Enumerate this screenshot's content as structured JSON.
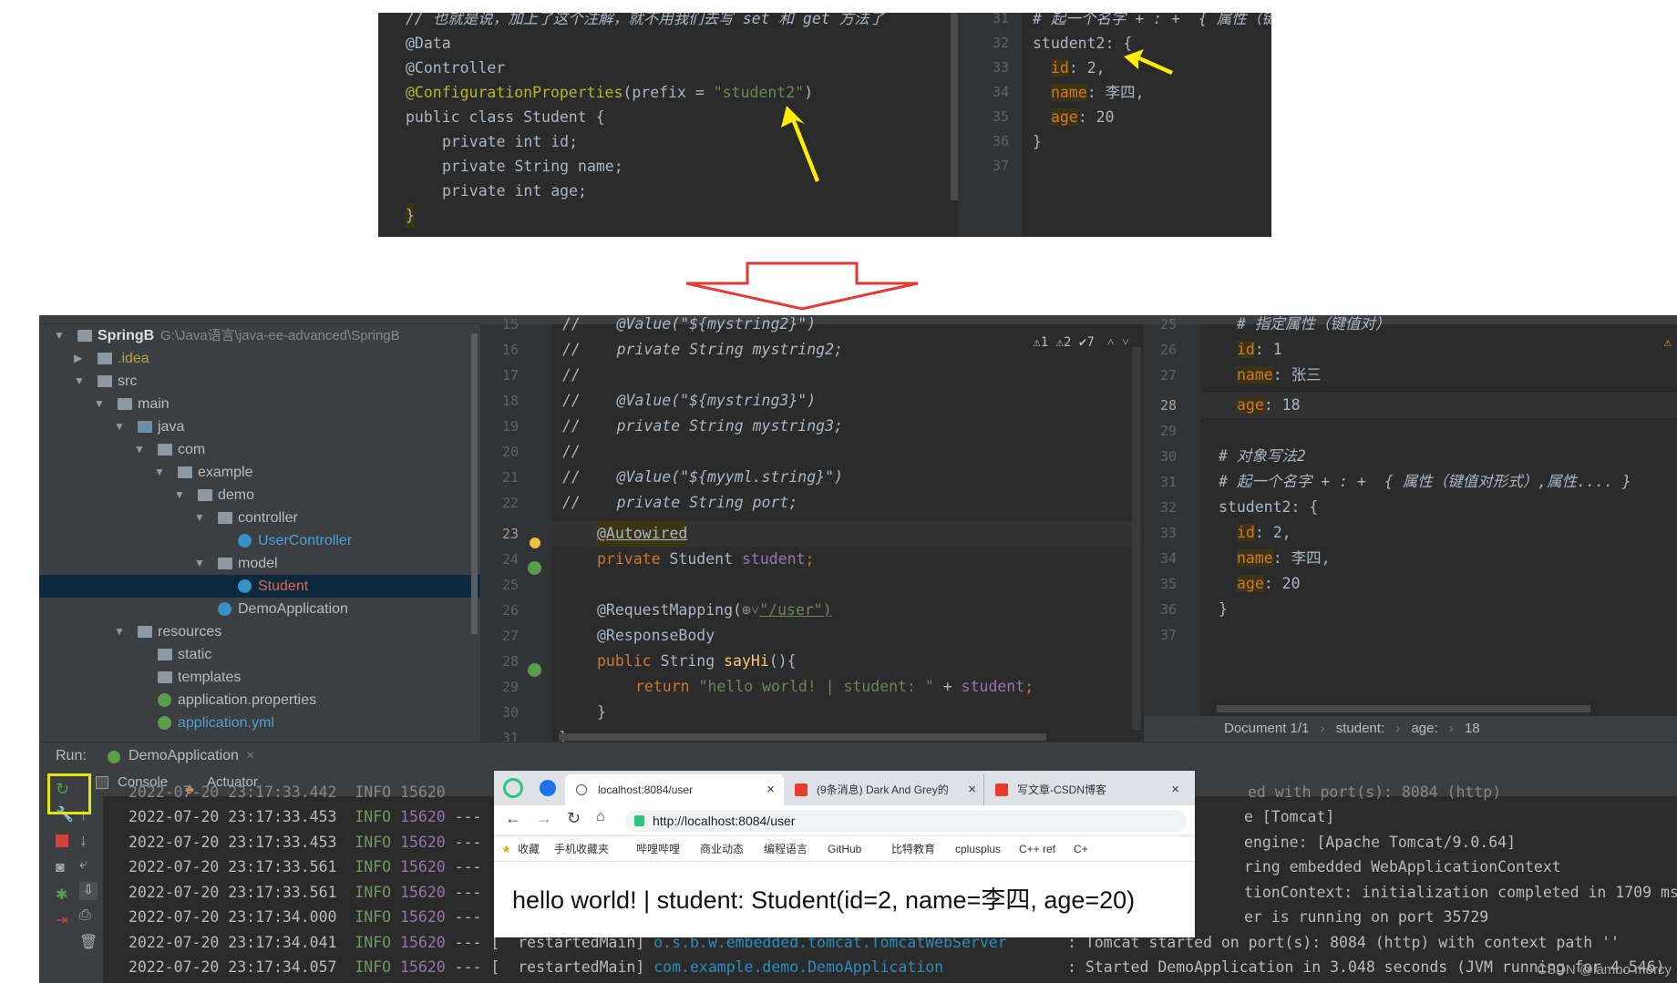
{
  "top_snippet": {
    "comment_line": "// 也就是说，加上了这个注解，就不用我们去写 set 和 get 方法了",
    "lines": [
      "@Data",
      "@Controller"
    ],
    "config_annotation": "@ConfigurationProperties",
    "config_prefix": "(prefix = ",
    "config_value": "\"student2\"",
    "class_decl": "public class Student {",
    "fields": [
      "private int id;",
      "private String name;",
      "private int age;"
    ],
    "closing": "}",
    "gutter": [
      "31",
      "32",
      "33",
      "34",
      "35",
      "36",
      "37"
    ],
    "yml_comment": "# 起一个名字 + : +  { 属性（键",
    "yml_root": "student2: {",
    "yml_entries": [
      {
        "key": "id",
        "value": ": 2,"
      },
      {
        "key": "name",
        "value": ": 李四,"
      },
      {
        "key": "age",
        "value": ": 20"
      }
    ],
    "yml_close": "}",
    "arrow_color": "#ffee00"
  },
  "project": {
    "root_name": "SpringB",
    "root_path": "G:\\Java语言\\java-ee-advanced\\SpringB",
    "items": [
      {
        "label": ".idea"
      },
      {
        "label": "src"
      },
      {
        "label": "main"
      },
      {
        "label": "java"
      },
      {
        "label": "com"
      },
      {
        "label": "example"
      },
      {
        "label": "demo"
      },
      {
        "label": "controller"
      },
      {
        "label": "UserController"
      },
      {
        "label": "model"
      },
      {
        "label": "Student"
      },
      {
        "label": "DemoApplication"
      },
      {
        "label": "resources"
      },
      {
        "label": "static"
      },
      {
        "label": "templates"
      },
      {
        "label": "application.properties"
      },
      {
        "label": "application.yml"
      }
    ]
  },
  "editor": {
    "warnings": "⚠1 ⚠2 ✔7",
    "line_numbers": [
      "15",
      "16",
      "17",
      "18",
      "19",
      "20",
      "21",
      "22",
      "23",
      "24",
      "25",
      "26",
      "27",
      "28",
      "29",
      "30",
      "31"
    ],
    "code": [
      "//    @Value(\"${mystring2}\")",
      "//    private String mystring2;",
      "//",
      "//    @Value(\"${mystring3}\")",
      "//    private String mystring3;",
      "//",
      "//    @Value(\"${myyml.string}\")",
      "//    private String port;",
      "@Autowired",
      "private Student student;",
      "",
      "@RequestMapping(",
      "@ResponseBody",
      "public String sayHi(){",
      "return \"hello world! | student: \" + student;",
      "}",
      "}"
    ],
    "mapping_path": "\"/user\")",
    "string_literal": "\"hello world! | student: \""
  },
  "yml": {
    "line_numbers": [
      "25",
      "26",
      "27",
      "28",
      "29",
      "30",
      "31",
      "32",
      "33",
      "34",
      "35",
      "36",
      "37"
    ],
    "lines": [
      {
        "comment": "# 指定属性（键值对）"
      },
      {
        "key": "id",
        "value": ": 1"
      },
      {
        "key": "name",
        "value": ": 张三"
      },
      {
        "key": "age",
        "value": ": 18"
      },
      {
        "text": ""
      },
      {
        "comment": "# 对象写法2"
      },
      {
        "comment": "# 起一个名字 + : +  { 属性（键值对形式）,属性.... }"
      },
      {
        "text": "student2: {"
      },
      {
        "key": "id",
        "value": ": 2,"
      },
      {
        "key": "name",
        "value": ": 李四,"
      },
      {
        "key": "age",
        "value": ": 20"
      },
      {
        "text": "}"
      },
      {
        "text": ""
      }
    ],
    "breadcrumb": [
      "Document 1/1",
      "student:",
      "age:",
      "18"
    ]
  },
  "run": {
    "label": "Run:",
    "config": "DemoApplication",
    "tabs": [
      "Console",
      "Actuator"
    ],
    "log": [
      {
        "ts": "2022-07-20 23:17:33.453",
        "level": "INFO",
        "pid": "15620",
        "sep": "---",
        "right": "e [Tomcat]"
      },
      {
        "ts": "2022-07-20 23:17:33.453",
        "level": "INFO",
        "pid": "15620",
        "sep": "---",
        "right": "engine: [Apache Tomcat/9.0.64]"
      },
      {
        "ts": "2022-07-20 23:17:33.561",
        "level": "INFO",
        "pid": "15620",
        "sep": "---",
        "right": "ring embedded WebApplicationContext"
      },
      {
        "ts": "2022-07-20 23:17:33.561",
        "level": "INFO",
        "pid": "15620",
        "sep": "---",
        "right": "tionContext: initialization completed in 1709 ms"
      },
      {
        "ts": "2022-07-20 23:17:34.000",
        "level": "INFO",
        "pid": "15620",
        "sep": "---",
        "right": "er is running on port 35729"
      },
      {
        "ts": "2022-07-20 23:17:34.041",
        "level": "INFO",
        "pid": "15620",
        "sep": "--- [",
        "thread": "restartedMain]",
        "logger": "o.s.b.w.embedded.tomcat.TomcatWebServer",
        "right": ": Tomcat started on port(s): 8084 (http) with context path ''"
      },
      {
        "ts": "2022-07-20 23:17:34.057",
        "level": "INFO",
        "pid": "15620",
        "sep": "--- [",
        "thread": "restartedMain]",
        "logger": "com.example.demo.DemoApplication",
        "right": ": Started DemoApplication in 3.048 seconds (JVM running for 4.546)"
      }
    ]
  },
  "browser": {
    "tabs": [
      "localhost:8084/user",
      "(9条消息) Dark And Grey的",
      "写文章-CSDN博客"
    ],
    "url": "http://localhost:8084/user",
    "bookmarks": [
      "收藏",
      "手机收藏夹",
      "哔哩哔哩",
      "商业动态",
      "编程语言",
      "GitHub",
      "比特教育",
      "cplusplus",
      "C++ ref",
      "C+"
    ],
    "body": "hello world! | student: Student(id=2, name=李四, age=20)"
  },
  "watermark": "CSDN @lambo mercy"
}
